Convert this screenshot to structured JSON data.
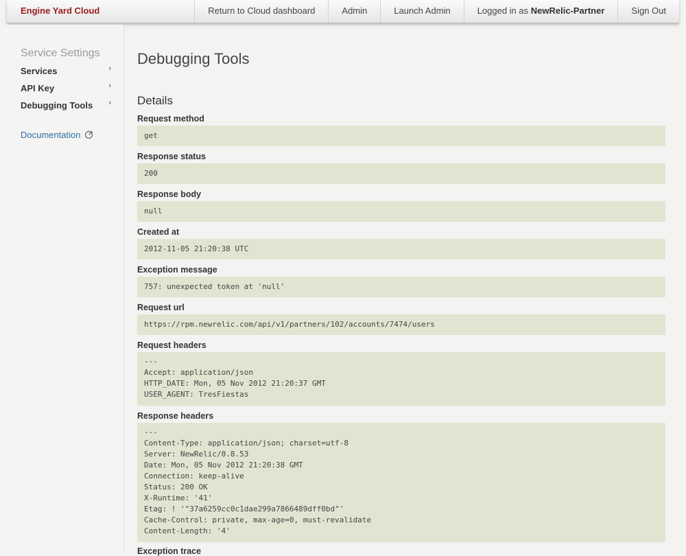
{
  "topbar": {
    "brand": "Engine Yard Cloud",
    "nav": [
      {
        "label": "Return to Cloud dashboard"
      },
      {
        "label": "Admin"
      },
      {
        "label": "Launch Admin"
      }
    ],
    "logged_in_prefix": "Logged in as ",
    "logged_in_user": "NewRelic-Partner",
    "sign_out": "Sign Out"
  },
  "sidebar": {
    "title": "Service Settings",
    "items": [
      {
        "label": "Services",
        "chevron": "›"
      },
      {
        "label": "API Key",
        "chevron": "›"
      },
      {
        "label": "Debugging Tools",
        "chevron": "›"
      }
    ],
    "documentation": "Documentation",
    "documentation_icon": "external-link-icon"
  },
  "main": {
    "title": "Debugging Tools",
    "section": "Details",
    "fields": [
      {
        "label": "Request method",
        "value": "get"
      },
      {
        "label": "Response status",
        "value": "200"
      },
      {
        "label": "Response body",
        "value": "null"
      },
      {
        "label": "Created at",
        "value": "2012-11-05 21:20:38 UTC"
      },
      {
        "label": "Exception message",
        "value": "757: unexpected token at 'null'"
      },
      {
        "label": "Request url",
        "value": "https://rpm.newrelic.com/api/v1/partners/102/accounts/7474/users"
      },
      {
        "label": "Request headers",
        "value": "---\nAccept: application/json\nHTTP_DATE: Mon, 05 Nov 2012 21:20:37 GMT\nUSER_AGENT: TresFiestas"
      },
      {
        "label": "Response headers",
        "value": "---\nContent-Type: application/json; charset=utf-8\nServer: NewRelic/0.8.53\nDate: Mon, 05 Nov 2012 21:20:38 GMT\nConnection: keep-alive\nStatus: 200 OK\nX-Runtime: '41'\nEtag: ! '\"37a6259cc0c1dae299a7866489dff0bd\"'\nCache-Control: private, max-age=0, must-revalidate\nContent-Length: '4'"
      },
      {
        "label": "Exception trace",
        "value": ""
      }
    ]
  },
  "colors": {
    "brand": "#9b1c1c",
    "link": "#2f6ea4",
    "field_bg": "#e2e4d1"
  }
}
